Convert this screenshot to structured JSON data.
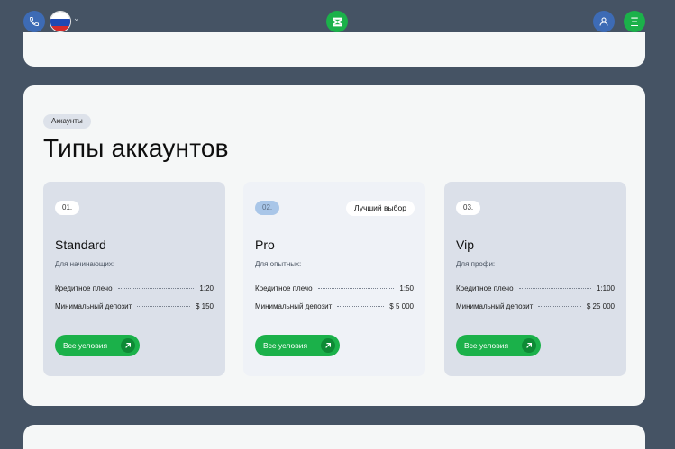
{
  "header": {
    "phone_icon": "phone-icon",
    "language_flag": "russia-flag",
    "logo_icon": "brand-logo-icon",
    "user_icon": "user-icon",
    "menu_icon": "menu-icon",
    "accent": "#1bb14a",
    "blue": "#3d6bb5"
  },
  "section": {
    "chip": "Аккаунты",
    "title": "Типы аккаунтов"
  },
  "cards": [
    {
      "num": "01.",
      "name": "Standard",
      "subtitle": "Для начинающих:",
      "leverage_label": "Кредитное плечо",
      "leverage_value": "1:20",
      "deposit_label": "Минимальный депозит",
      "deposit_value": "$ 150",
      "button": "Все условия"
    },
    {
      "num": "02.",
      "badge": "Лучший выбор",
      "name": "Pro",
      "subtitle": "Для опытных:",
      "leverage_label": "Кредитное плечо",
      "leverage_value": "1:50",
      "deposit_label": "Минимальный депозит",
      "deposit_value": "$ 5 000",
      "button": "Все условия"
    },
    {
      "num": "03.",
      "name": "Vip",
      "subtitle": "Для профи:",
      "leverage_label": "Кредитное плечо",
      "leverage_value": "1:100",
      "deposit_label": "Минимальный депозит",
      "deposit_value": "$ 25 000",
      "button": "Все условия"
    }
  ]
}
